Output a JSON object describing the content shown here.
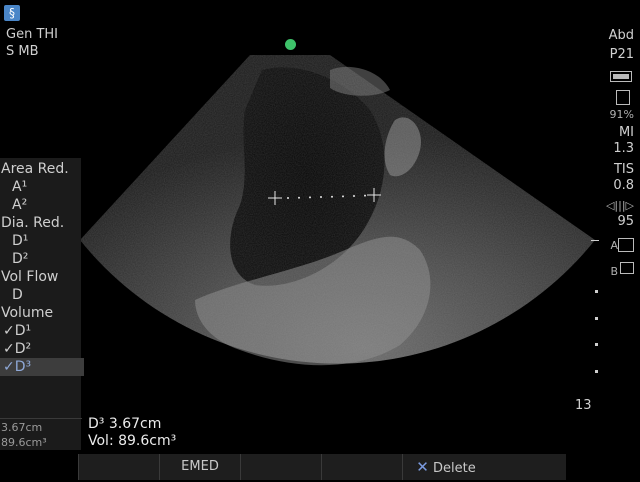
{
  "top_left": {
    "logo_icon": "sonosite-logo-icon",
    "line1": "Gen  THI",
    "line2": "S      MB"
  },
  "right_panel": {
    "exam": "Abd",
    "transducer": "P21",
    "storage_percent": "91%",
    "mi_label": "MI",
    "mi_value": "1.3",
    "tis_label": "TIS",
    "tis_value": "0.8",
    "gain_value": "95",
    "a_label": "A",
    "b_label": "B"
  },
  "menu": {
    "area_red": "Area Red.",
    "a1": "A¹",
    "a2": "A²",
    "dia_red": "Dia. Red.",
    "d1": "D¹",
    "d2": "D²",
    "vol_flow": "Vol Flow",
    "d": "D",
    "volume": "Volume",
    "v_d1": "✓D¹",
    "v_d2": "✓D²",
    "v_d3": "✓D³",
    "val1": "3.67cm",
    "val2": "89.6cm³"
  },
  "result": {
    "line1": "D³  3.67cm",
    "line2": "Vol: 89.6cm³"
  },
  "bottom_bar": {
    "emed": "EMED",
    "delete": "Delete"
  },
  "depth": {
    "value": "13"
  },
  "colors": {
    "marker": "#3ec26a",
    "menu_selected_text": "#8fa9d8"
  }
}
